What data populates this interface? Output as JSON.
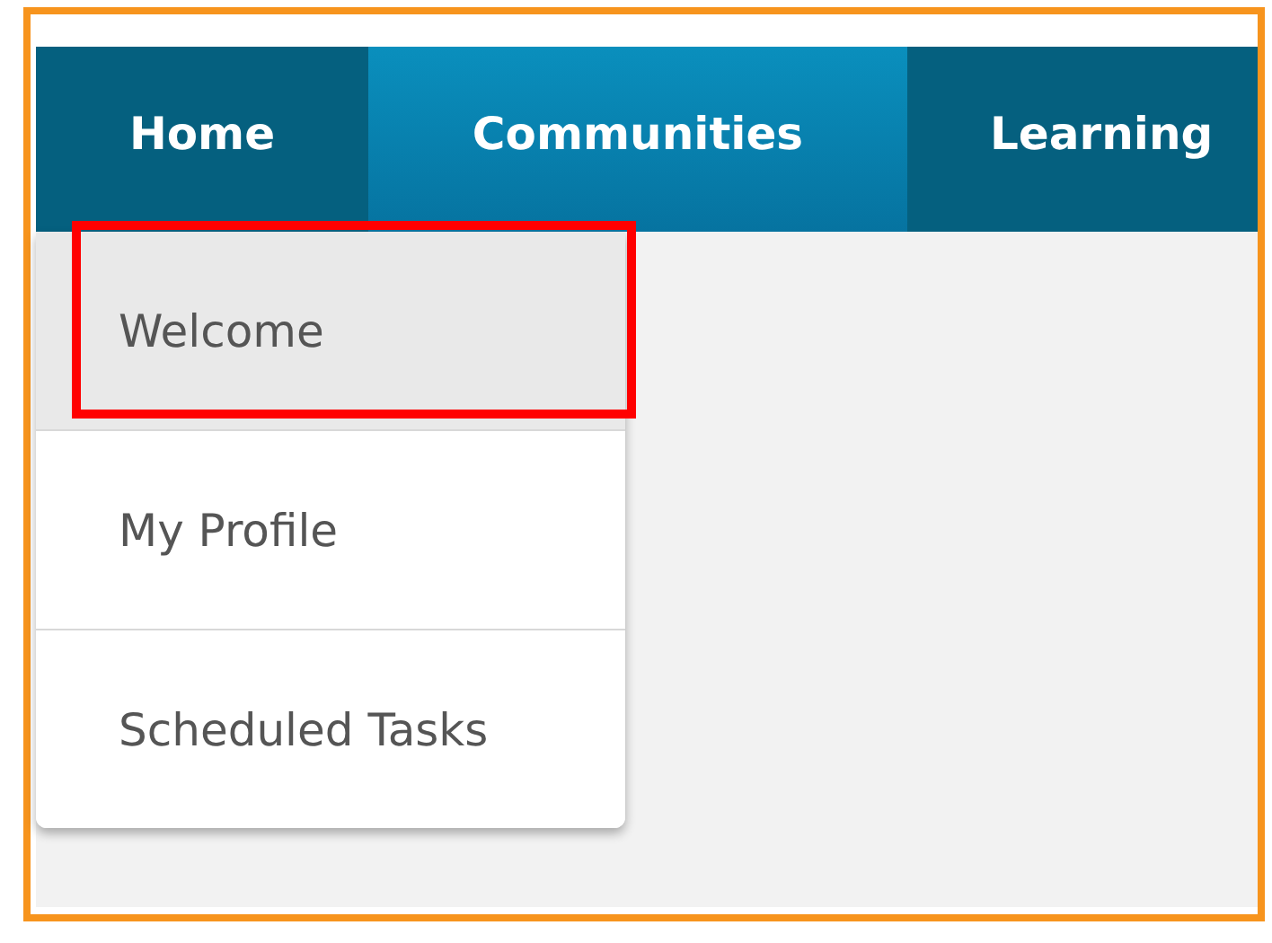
{
  "nav": {
    "tabs": [
      {
        "label": "Home",
        "selected": false
      },
      {
        "label": "Communities",
        "selected": true
      },
      {
        "label": "Learning",
        "selected": false
      }
    ]
  },
  "dropdown": {
    "items": [
      {
        "label": "Welcome",
        "selected": true,
        "annotated": true
      },
      {
        "label": "My Profile",
        "selected": false,
        "annotated": false
      },
      {
        "label": "Scheduled Tasks",
        "selected": false,
        "annotated": false
      }
    ]
  }
}
